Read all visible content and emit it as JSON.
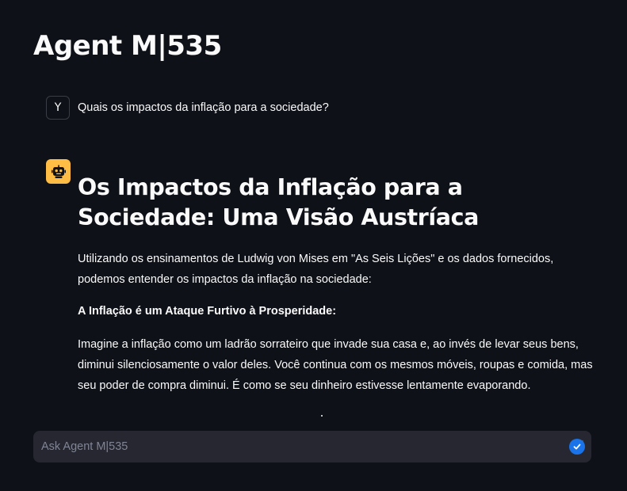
{
  "app": {
    "title": "Agent M|535"
  },
  "messages": {
    "user": {
      "avatar_letter": "Y",
      "text": "Quais os impactos da inflação para a sociedade?"
    },
    "assistant": {
      "avatar_icon": "robot-icon",
      "heading": "Os Impactos da Inflação para a Sociedade: Uma Visão Austríaca",
      "intro": "Utilizando os ensinamentos de Ludwig von Mises em \"As Seis Lições\" e os dados fornecidos, podemos entender os impactos da inflação na sociedade:",
      "subheading": "A Inflação é um Ataque Furtivo à Prosperidade:",
      "body": "Imagine a inflação como um ladrão sorrateiro que invade sua casa e, ao invés de levar seus bens, diminui silenciosamente o valor deles. Você continua com os mesmos móveis, roupas e comida, mas seu poder de compra diminui. É como se seu dinheiro estivesse lentamente evaporando."
    }
  },
  "chat_input": {
    "placeholder": "Ask Agent M|535",
    "value": "",
    "send_icon": "send-icon"
  },
  "colors": {
    "background": "#0e1117",
    "input_background": "#262730",
    "assistant_avatar": "#ffbd45",
    "text": "#fafafa",
    "placeholder": "#808495",
    "grammarly_badge": "#1a73e8"
  }
}
